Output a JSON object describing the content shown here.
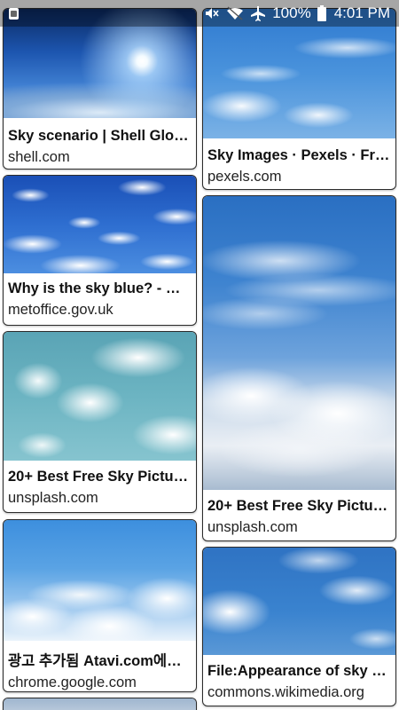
{
  "status_bar": {
    "battery": "100%",
    "time": "4:01 PM",
    "icons": [
      "app-notification-icon",
      "mute-icon",
      "wifi-icon",
      "airplane-mode-icon",
      "battery-icon"
    ]
  },
  "results": {
    "left_column": [
      {
        "title": "Sky scenario | Shell Glob…",
        "source": "shell.com",
        "image": "sky-space-thumbnail"
      },
      {
        "title": "Why is the sky blue? - M…",
        "source": "metoffice.gov.uk",
        "image": "sky-puffy-clouds-thumbnail"
      },
      {
        "title": "20+ Best Free Sky Pictur…",
        "source": "unsplash.com",
        "image": "sky-teal-clouds-thumbnail"
      },
      {
        "title": "광고 추가됨 Atavi.com에…",
        "source": "chrome.google.com",
        "image": "sky-bottom-clouds-thumbnail"
      }
    ],
    "right_column": [
      {
        "title": "Sky Images · Pexels · Fr…",
        "source": "pexels.com",
        "image": "sky-cloudy-thumbnail"
      },
      {
        "title": "20+ Best Free Sky Pictur…",
        "source": "unsplash.com",
        "image": "sky-above-clouds-thumbnail"
      },
      {
        "title": "File:Appearance of sky f…",
        "source": "commons.wikimedia.org",
        "image": "sky-left-cloud-thumbnail"
      }
    ]
  }
}
